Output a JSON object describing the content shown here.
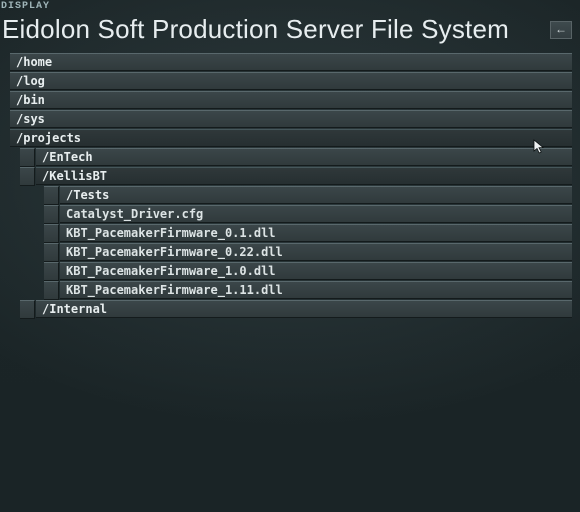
{
  "display_label": "DISPLAY",
  "header": {
    "title": "Eidolon Soft Production Server File System",
    "back_glyph": "←"
  },
  "tree": [
    {
      "label": "/home",
      "type": "dir",
      "depth": 0,
      "selected": false
    },
    {
      "label": "/log",
      "type": "dir",
      "depth": 0,
      "selected": false
    },
    {
      "label": "/bin",
      "type": "dir",
      "depth": 0,
      "selected": false
    },
    {
      "label": "/sys",
      "type": "dir",
      "depth": 0,
      "selected": false
    },
    {
      "label": "/projects",
      "type": "dir",
      "depth": 0,
      "selected": true
    },
    {
      "label": "/EnTech",
      "type": "dir",
      "depth": 1,
      "selected": false
    },
    {
      "label": "/KellisBT",
      "type": "dir",
      "depth": 1,
      "selected": true
    },
    {
      "label": "/Tests",
      "type": "dir",
      "depth": 2,
      "selected": false
    },
    {
      "label": "Catalyst_Driver.cfg",
      "type": "file",
      "depth": 2,
      "selected": false
    },
    {
      "label": "KBT_PacemakerFirmware_0.1.dll",
      "type": "file",
      "depth": 2,
      "selected": false
    },
    {
      "label": "KBT_PacemakerFirmware_0.22.dll",
      "type": "file",
      "depth": 2,
      "selected": false
    },
    {
      "label": "KBT_PacemakerFirmware_1.0.dll",
      "type": "file",
      "depth": 2,
      "selected": false
    },
    {
      "label": "KBT_PacemakerFirmware_1.11.dll",
      "type": "file",
      "depth": 2,
      "selected": false
    },
    {
      "label": "/Internal",
      "type": "dir",
      "depth": 1,
      "selected": false
    }
  ]
}
